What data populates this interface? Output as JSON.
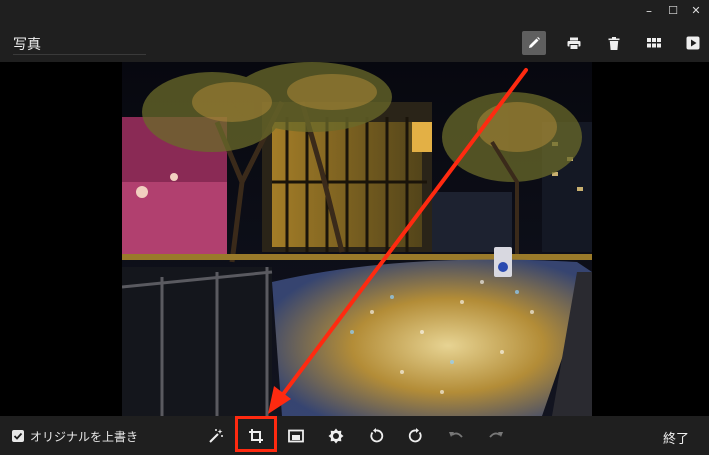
{
  "header": {
    "title": "写真",
    "tools": [
      {
        "name": "edit-button",
        "icon": "pencil-icon"
      },
      {
        "name": "print-button",
        "icon": "printer-icon"
      },
      {
        "name": "delete-button",
        "icon": "trash-icon"
      },
      {
        "name": "gallery-button",
        "icon": "grid-icon"
      },
      {
        "name": "slideshow-button",
        "icon": "play-icon"
      }
    ]
  },
  "window_controls": {
    "minimize": "–",
    "maximize": "☐",
    "close": "✕"
  },
  "editbar": {
    "overwrite_label": "オリジナルを上書き",
    "overwrite_checked": true,
    "done_label": "終了",
    "tools": [
      "auto-fix-icon",
      "crop-icon",
      "aspect-icon",
      "brightness-icon",
      "rotate-left-icon",
      "rotate-right-icon",
      "undo-icon",
      "redo-icon"
    ]
  },
  "colors": {
    "accent": "#ff2a10",
    "bar": "#1f1f1f",
    "active_tool": "#5f5f5f"
  }
}
